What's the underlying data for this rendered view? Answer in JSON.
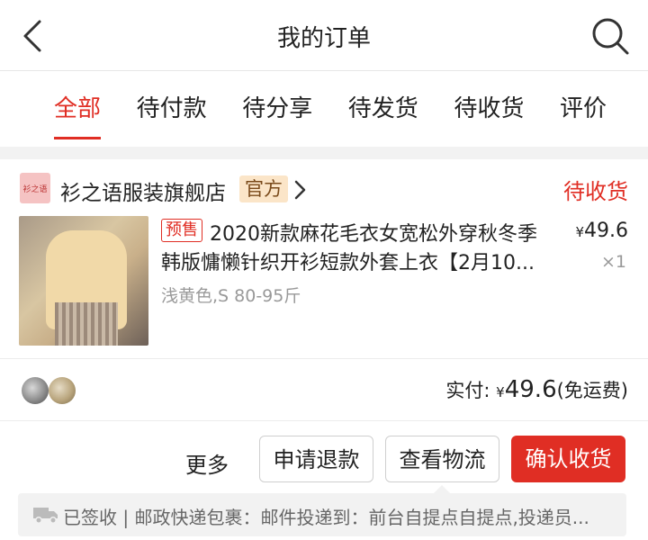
{
  "header": {
    "title": "我的订单",
    "back_icon": "back-arrow-icon",
    "search_icon": "search-icon"
  },
  "tabs": [
    {
      "label": "全部",
      "active": true
    },
    {
      "label": "待付款",
      "active": false
    },
    {
      "label": "待分享",
      "active": false
    },
    {
      "label": "待发货",
      "active": false
    },
    {
      "label": "待收货",
      "active": false
    },
    {
      "label": "评价",
      "active": false
    }
  ],
  "order": {
    "shop": {
      "logo_text": "衫之语",
      "name": "衫之语服装旗舰店",
      "badge": "官方"
    },
    "status": "待收货",
    "product": {
      "tag": "预售",
      "title_line1": "2020新款麻花毛衣女宽松外穿秋冬季",
      "title_line2": "韩版慵懒针织开衫短款外套上衣【2月10...",
      "variant": "浅黄色,S 80-95斤",
      "currency": "¥",
      "price": "49.6",
      "quantity": "×1"
    },
    "payment": {
      "label": "实付:",
      "currency": "¥",
      "amount": "49.6",
      "note": "(免运费)"
    },
    "actions": {
      "more": "更多",
      "refund": "申请退款",
      "logistics": "查看物流",
      "confirm": "确认收货"
    },
    "logistics_info": "已签收 | 邮政快递包裹：邮件投递到：前台自提点自提点,投递员..."
  },
  "colors": {
    "accent": "#e02e24",
    "official_bg": "#fbe5c8",
    "separator": "#f2f2f2"
  }
}
